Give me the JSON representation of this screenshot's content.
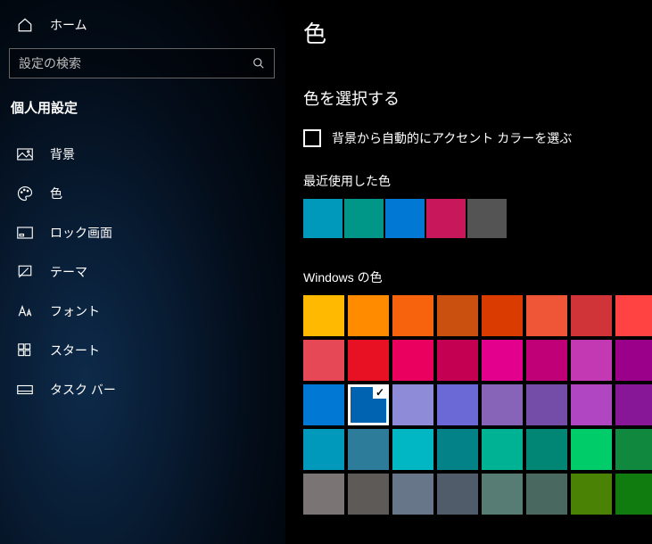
{
  "sidebar": {
    "home": "ホーム",
    "search_placeholder": "設定の検索",
    "category": "個人用設定",
    "items": [
      {
        "label": "背景"
      },
      {
        "label": "色"
      },
      {
        "label": "ロック画面"
      },
      {
        "label": "テーマ"
      },
      {
        "label": "フォント"
      },
      {
        "label": "スタート"
      },
      {
        "label": "タスク バー"
      }
    ]
  },
  "main": {
    "title": "色",
    "section_title": "色を選択する",
    "auto_checkbox_label": "背景から自動的にアクセント カラーを選ぶ",
    "recent_heading": "最近使用した色",
    "windows_heading": "Windows の色",
    "recent_colors": [
      "#0099bc",
      "#009688",
      "#0078d4",
      "#c9175b",
      "#545454"
    ],
    "windows_colors": [
      "#ffb900",
      "#ff8c00",
      "#f7630c",
      "#ca5010",
      "#da3b01",
      "#ef5537",
      "#d13438",
      "#ff4343",
      "#e74856",
      "#e81123",
      "#ea005e",
      "#c30052",
      "#e3008c",
      "#bf0077",
      "#c239b3",
      "#9a0089",
      "#0078d4",
      "#0063b1",
      "#8e8cd8",
      "#6b69d6",
      "#8764b8",
      "#744da9",
      "#b146c2",
      "#881798",
      "#0099bc",
      "#2d7d9a",
      "#00b7c3",
      "#038387",
      "#00b294",
      "#018574",
      "#00cc6a",
      "#10893e",
      "#7a7574",
      "#5d5a58",
      "#68768a",
      "#515c6b",
      "#567c73",
      "#486860",
      "#498205",
      "#107c10"
    ],
    "selected_index": 17
  }
}
